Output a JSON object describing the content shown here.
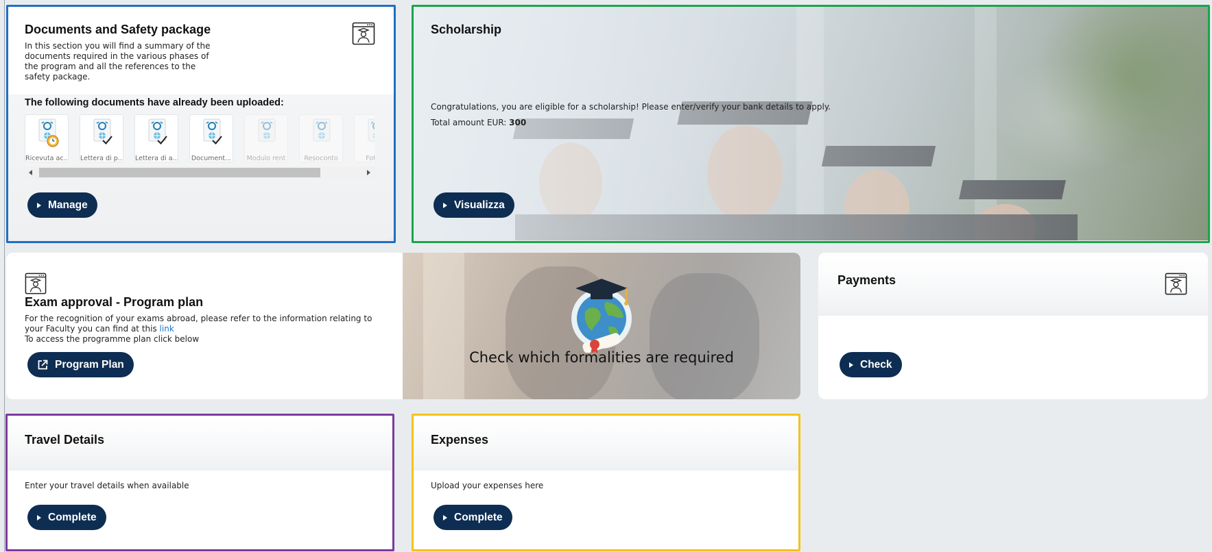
{
  "documents": {
    "title": "Documents and Safety package",
    "desc": "In this section you will find a summary of the documents required in the various phases of the program and all the references to the safety package.",
    "uploaded_heading": "The following documents have already been uploaded:",
    "files": [
      {
        "label": "Ricevuta ac...",
        "status": "pending"
      },
      {
        "label": "Lettera di p...",
        "status": "done"
      },
      {
        "label": "Lettera di a...",
        "status": "done"
      },
      {
        "label": "Document...",
        "status": "done"
      },
      {
        "label": "Modulo rent",
        "status": "missing"
      },
      {
        "label": "Resoconto",
        "status": "missing"
      },
      {
        "label": "Foto d",
        "status": "missing"
      }
    ],
    "button": "Manage"
  },
  "scholarship": {
    "title": "Scholarship",
    "message": "Congratulations, you are eligible for a scholarship! Please enter/verify your bank details to apply.",
    "amount_label": "Total amount EUR:",
    "amount_value": "300",
    "button": "Visualizza"
  },
  "exam": {
    "title": "Exam approval - Program plan",
    "desc1": "For the recognition of your exams abroad, please refer to the information relating to your Faculty you can find at this",
    "link": "link",
    "desc2": "To access the programme plan click below",
    "button": "Program Plan",
    "banner_text": "Check which formalities are required"
  },
  "payments": {
    "title": "Payments",
    "button": "Check"
  },
  "travel": {
    "title": "Travel Details",
    "desc": "Enter your travel details when available",
    "button": "Complete"
  },
  "expenses": {
    "title": "Expenses",
    "desc": "Upload your expenses here",
    "button": "Complete"
  },
  "colors": {
    "button_bg": "#0e2d52",
    "outline_blue": "#1f6fc1",
    "outline_green": "#19a64a",
    "outline_purple": "#7a3a9e",
    "outline_yellow": "#f5c21b"
  }
}
